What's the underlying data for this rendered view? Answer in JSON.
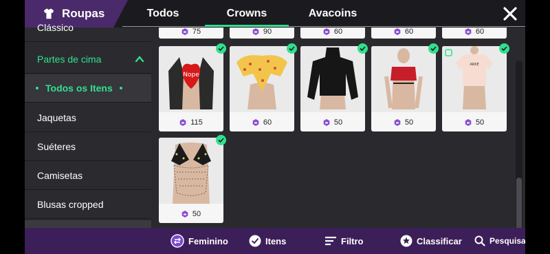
{
  "header": {
    "title": "Roupas",
    "tabs": [
      {
        "label": "Todos",
        "active": false
      },
      {
        "label": "Crowns",
        "active": true
      },
      {
        "label": "Avacoins",
        "active": false
      }
    ]
  },
  "sidebar": {
    "items": [
      {
        "label": "Clássico"
      },
      {
        "label": "Partes de cima",
        "expanded": true
      },
      {
        "label": "Todos os Itens",
        "selected": true
      },
      {
        "label": "Jaquetas"
      },
      {
        "label": "Suéteres"
      },
      {
        "label": "Camisetas"
      },
      {
        "label": "Blusas cropped"
      }
    ]
  },
  "grid": {
    "top_row_prices": [
      "75",
      "90",
      "60",
      "60",
      "60"
    ],
    "items": [
      {
        "price": "115",
        "owned": true,
        "desc": "heart top with jacket"
      },
      {
        "price": "60",
        "owned": true,
        "desc": "yellow floral top"
      },
      {
        "price": "50",
        "owned": true,
        "desc": "black turtleneck"
      },
      {
        "price": "50",
        "owned": true,
        "desc": "red crop tee"
      },
      {
        "price": "50",
        "owned": true,
        "desc": "white crop tee"
      },
      {
        "price": "50",
        "owned": true,
        "desc": "chain bikini top"
      }
    ]
  },
  "bottom_bar": {
    "gender": "Feminino",
    "items": "Itens",
    "filter": "Filtro",
    "sort": "Classificar",
    "search": "Pesquisa"
  },
  "colors": {
    "accent": "#31e08f",
    "purple": "#4a2a6a",
    "bottom": "#3c1f58",
    "crown": "#8a4bd0"
  }
}
